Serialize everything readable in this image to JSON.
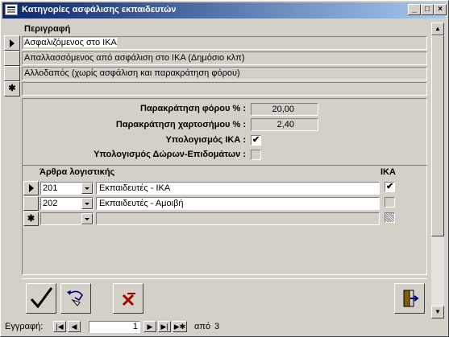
{
  "window": {
    "title": "Κατηγορίες ασφάλισης εκπαιδευτών"
  },
  "main_list": {
    "header": "Περιγραφή",
    "rows": [
      {
        "label": "Ασφαλιζόμενος στο ΙΚΑ"
      },
      {
        "label": "Απαλλασσόμενος από ασφάλιση στο ΙΚΑ (Δημόσιο κλπ)"
      },
      {
        "label": "Αλλοδαπός (χωρίς ασφάλιση και παρακράτηση φόρου)"
      }
    ],
    "new_row_marker": "✱"
  },
  "detail": {
    "tax_withholding_label": "Παρακράτηση φόρου % :",
    "tax_withholding_value": "20,00",
    "stamp_label": "Παρακράτηση χαρτοσήμου % :",
    "stamp_value": "2,40",
    "ika_calc_label": "Υπολογισμός ΙΚΑ :",
    "ika_calc_checked": true,
    "gifts_calc_label": "Υπολογισμός Δώρων-Επιδομάτων :",
    "gifts_calc_checked": false
  },
  "accounting": {
    "header_label": "Άρθρα λογιστικής",
    "header_ika": "ΙΚΑ",
    "rows": [
      {
        "code": "201",
        "description": "Εκπαιδευτές - ΙΚΑ",
        "ika": true
      },
      {
        "code": "202",
        "description": "Εκπαιδευτές - Αμοιβή",
        "ika": false
      }
    ],
    "new_row_marker": "✱"
  },
  "toolbar": {
    "save_icon": "checkmark-icon",
    "undo_icon": "undo-icon",
    "delete_icon": "delete-icon",
    "exit_icon": "exit-door-icon"
  },
  "navigation": {
    "record_label": "Εγγραφή:",
    "current_record": "1",
    "of_label": "από",
    "total_records": "3"
  }
}
